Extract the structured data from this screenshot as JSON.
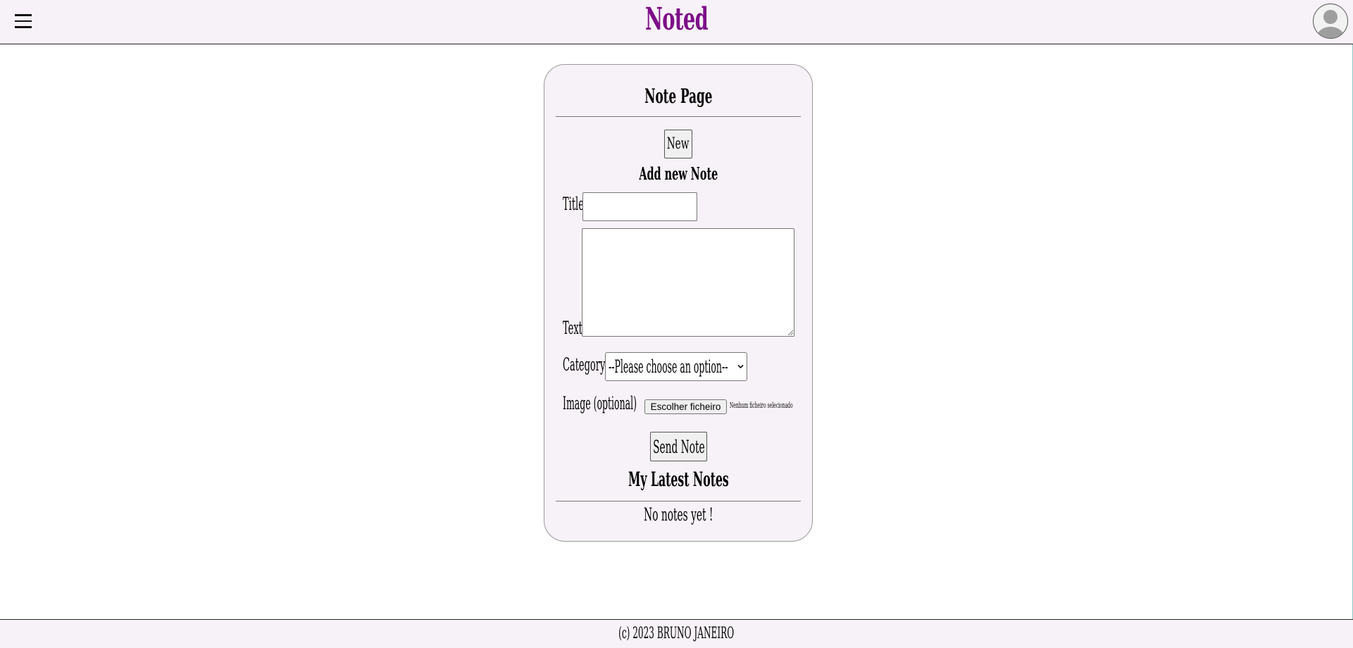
{
  "header": {
    "app_title": "Noted",
    "menu_icon": "hamburger-menu-icon",
    "avatar_icon": "user-avatar-icon"
  },
  "note_page": {
    "title": "Note Page",
    "new_button": "New",
    "add_heading": "Add new Note",
    "title_label": "Title",
    "title_value": "",
    "text_label": "Text",
    "text_value": "",
    "category_label": "Category",
    "category_selected": "--Please choose an option--",
    "image_label": "Image (optional)",
    "file_button": "Escolher ficheiro",
    "file_status": "Nenhum ficheiro selecionado",
    "send_button": "Send Note",
    "latest_heading": "My Latest Notes",
    "empty_message": "No notes yet !"
  },
  "footer": {
    "text": "(c) 2023 BRUNO JANEIRO"
  },
  "colors": {
    "brand": "#7d0f88",
    "surface": "#f7f2f7"
  }
}
